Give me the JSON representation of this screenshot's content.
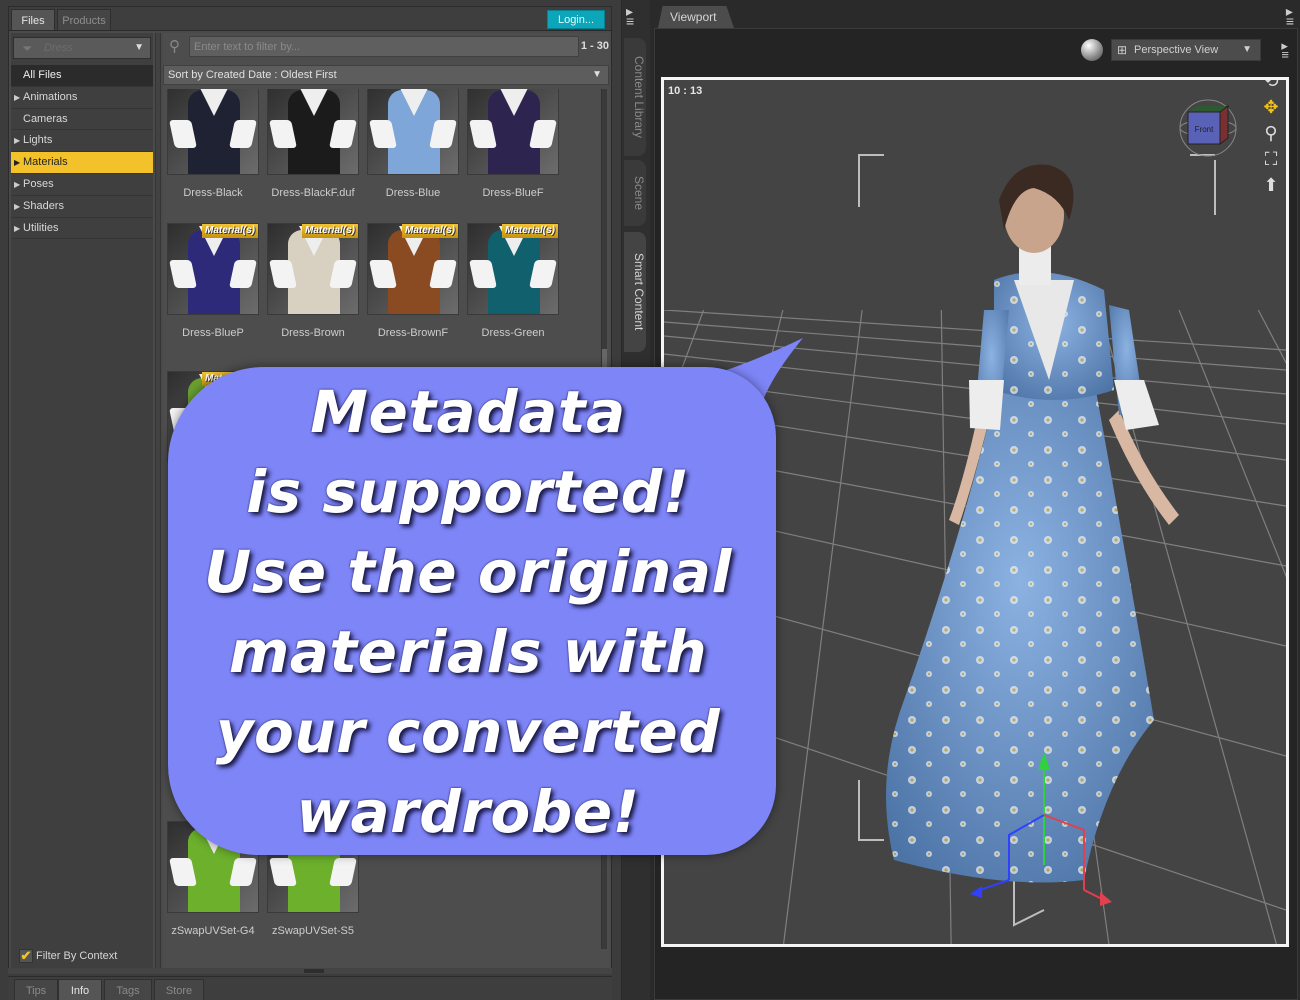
{
  "left_panel": {
    "tabs": [
      {
        "label": "Files",
        "active": true
      },
      {
        "label": "Products",
        "active": false
      }
    ],
    "login_label": "Login...",
    "category_filter": {
      "value": "Dress",
      "icon": "funnel-icon"
    },
    "categories": [
      {
        "label": "All Files",
        "expandable": false,
        "selected": false
      },
      {
        "label": "Animations",
        "expandable": true,
        "selected": false
      },
      {
        "label": "Cameras",
        "expandable": false,
        "selected": false
      },
      {
        "label": "Lights",
        "expandable": true,
        "selected": false
      },
      {
        "label": "Materials",
        "expandable": true,
        "selected": true
      },
      {
        "label": "Poses",
        "expandable": true,
        "selected": false
      },
      {
        "label": "Shaders",
        "expandable": true,
        "selected": false
      },
      {
        "label": "Utilities",
        "expandable": true,
        "selected": false
      }
    ],
    "filter_by_context": {
      "label": "Filter By Context",
      "checked": true
    },
    "search": {
      "placeholder": "Enter text to filter by...",
      "value": ""
    },
    "range_label": "1 - 30",
    "sort_label": "Sort by Created Date : Oldest First",
    "badge_label": "Material(s)",
    "items": [
      {
        "label": "Dress-Black",
        "color": "#1e2233",
        "badge": false
      },
      {
        "label": "Dress-BlackF.duf",
        "color": "#1b1b1b",
        "badge": false
      },
      {
        "label": "Dress-Blue",
        "color": "#7ea6d8",
        "badge": false
      },
      {
        "label": "Dress-BlueF",
        "color": "#2e2450",
        "badge": false
      },
      {
        "label": "Dress-BlueP",
        "color": "#2d2a7a",
        "badge": true
      },
      {
        "label": "Dress-Brown",
        "color": "#d8d0c0",
        "badge": true
      },
      {
        "label": "Dress-BrownF",
        "color": "#8a4a22",
        "badge": true
      },
      {
        "label": "Dress-Green",
        "color": "#10606e",
        "badge": true
      },
      {
        "label": "",
        "color": "#6aa030",
        "badge": true
      },
      {
        "label": "zSwapUVSet-G4",
        "color": "#6cb02c",
        "badge": false
      },
      {
        "label": "zSwapUVSet-S5",
        "color": "#6cb02c",
        "badge": false
      }
    ],
    "bottom_tabs": [
      {
        "label": "Tips",
        "active": false
      },
      {
        "label": "Info",
        "active": true
      },
      {
        "label": "Tags",
        "active": false
      },
      {
        "label": "Store",
        "active": false
      }
    ]
  },
  "side_tabs": [
    {
      "label": "Content Library",
      "active": false
    },
    {
      "label": "Scene",
      "active": false
    },
    {
      "label": "Smart Content",
      "active": true
    }
  ],
  "viewport": {
    "tab_label": "Viewport",
    "view_select": "Perspective View",
    "fps": "10 : 13",
    "cube_face": "Front",
    "nav_tools": [
      "orbit-icon",
      "move-icon",
      "zoom-icon",
      "frame-icon",
      "reset-icon"
    ]
  },
  "callout": {
    "lines": [
      "Metadata",
      "is supported!",
      "Use the original",
      "materials with",
      "your converted",
      "wardrobe!"
    ],
    "color": "#7e85f7"
  },
  "colors": {
    "accent_selected": "#f3c22a",
    "login": "#0ba6b9",
    "dress_blue": "#6f95c8"
  }
}
